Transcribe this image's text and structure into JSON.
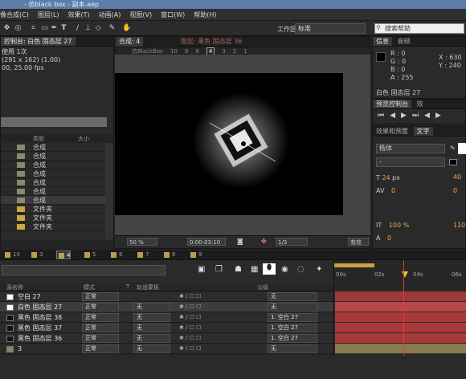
{
  "window_title": "- 仿black box - 副本.aep",
  "menu": [
    "像合成(C)",
    "图层(L)",
    "效果(T)",
    "动画(A)",
    "视图(V)",
    "窗口(W)",
    "帮助(H)"
  ],
  "toolbar": {
    "workspace_label": "工作区:",
    "workspace_value": "标准",
    "search_placeholder": "搜索帮助"
  },
  "left_panel": {
    "header": "控制台: 白色 固态层 27",
    "info_lines": [
      "使用 1次",
      "(291 x 162) (1.00)",
      "00, 25.00 fps"
    ],
    "col_type": "类型",
    "col_size": "大小",
    "rows": [
      {
        "type": "合成",
        "color": "#8a8a6e"
      },
      {
        "type": "合成",
        "color": "#8a8a6e"
      },
      {
        "type": "合成",
        "color": "#8a8a6e"
      },
      {
        "type": "合成",
        "color": "#8a8a6e"
      },
      {
        "type": "合成",
        "color": "#8a8a6e"
      },
      {
        "type": "合成",
        "color": "#8a8a6e"
      },
      {
        "type": "合成",
        "color": "#8a8a6e"
      },
      {
        "type": "文件夹",
        "color": "#c8a840"
      },
      {
        "type": "文件夹",
        "color": "#c8a840"
      },
      {
        "type": "文件夹",
        "color": "#c8a840"
      }
    ]
  },
  "viewer": {
    "tab_comp": "合成: 4",
    "tab_layer": "图层: 黑色 固态层 36",
    "breadcrumbs": [
      "仿BlackBox",
      "10",
      "9",
      "8",
      "4",
      "3",
      "2",
      "1"
    ],
    "active_crumb": "4",
    "zoom": "50 %",
    "timecode": "0:00:03:10",
    "resolution": "1/3",
    "active_label": "有效"
  },
  "info": {
    "tab": "信息",
    "tab2": "音频",
    "r": "R : 0",
    "g": "G : 0",
    "b": "B : 0",
    "a": "A : 255",
    "x": "X : 630",
    "y": "Y : 240",
    "footer": "白色 固态层 27"
  },
  "preview": {
    "tab": "预览控制台",
    "tab2": "效"
  },
  "chars": {
    "tab": "效果和预置",
    "tab2": "文字",
    "font": "楷体",
    "style": "-",
    "size": "24",
    "size_unit": "px",
    "leading": "40",
    "kerning": "0",
    "tracking": "0",
    "vscale": "100 %",
    "hscale": "110",
    "baseline": "0"
  },
  "timeline": {
    "tabs": [
      {
        "label": "10"
      },
      {
        "label": "3"
      },
      {
        "label": "4"
      },
      {
        "label": "5"
      },
      {
        "label": "6"
      },
      {
        "label": "7"
      },
      {
        "label": "8"
      },
      {
        "label": "9"
      }
    ],
    "active_tab": "4",
    "cols": {
      "name": "源名称",
      "mode": "模式",
      "t": "T",
      "trkmat": "轨道蒙板",
      "parent": "父级"
    },
    "ruler": [
      "00s",
      "02s",
      "04s",
      "06s"
    ],
    "layers": [
      {
        "name": "空白 27",
        "mode": "正常",
        "trkmat": "",
        "parent": "无",
        "color": "#ffffff",
        "selected": false,
        "bar": "#9b3a3a"
      },
      {
        "name": "白色 固态层 27",
        "mode": "正常",
        "trkmat": "无",
        "parent": "无",
        "color": "#ffffff",
        "selected": true,
        "bar": "#b84848"
      },
      {
        "name": "黑色 固态层 38",
        "mode": "正常",
        "trkmat": "无",
        "parent": "1. 空白 27",
        "color": "#111111",
        "selected": false,
        "bar": "#a83a3a"
      },
      {
        "name": "黑色 固态层 37",
        "mode": "正常",
        "trkmat": "无",
        "parent": "1. 空白 27",
        "color": "#111111",
        "selected": false,
        "bar": "#a83a3a"
      },
      {
        "name": "黑色 固态层 36",
        "mode": "正常",
        "trkmat": "无",
        "parent": "1. 空白 27",
        "color": "#111111",
        "selected": false,
        "bar": "#a83a3a"
      },
      {
        "name": "3",
        "mode": "正常",
        "trkmat": "无",
        "parent": "无",
        "color": "#7a8a6a",
        "selected": false,
        "bar": "#8a7a50"
      }
    ]
  }
}
